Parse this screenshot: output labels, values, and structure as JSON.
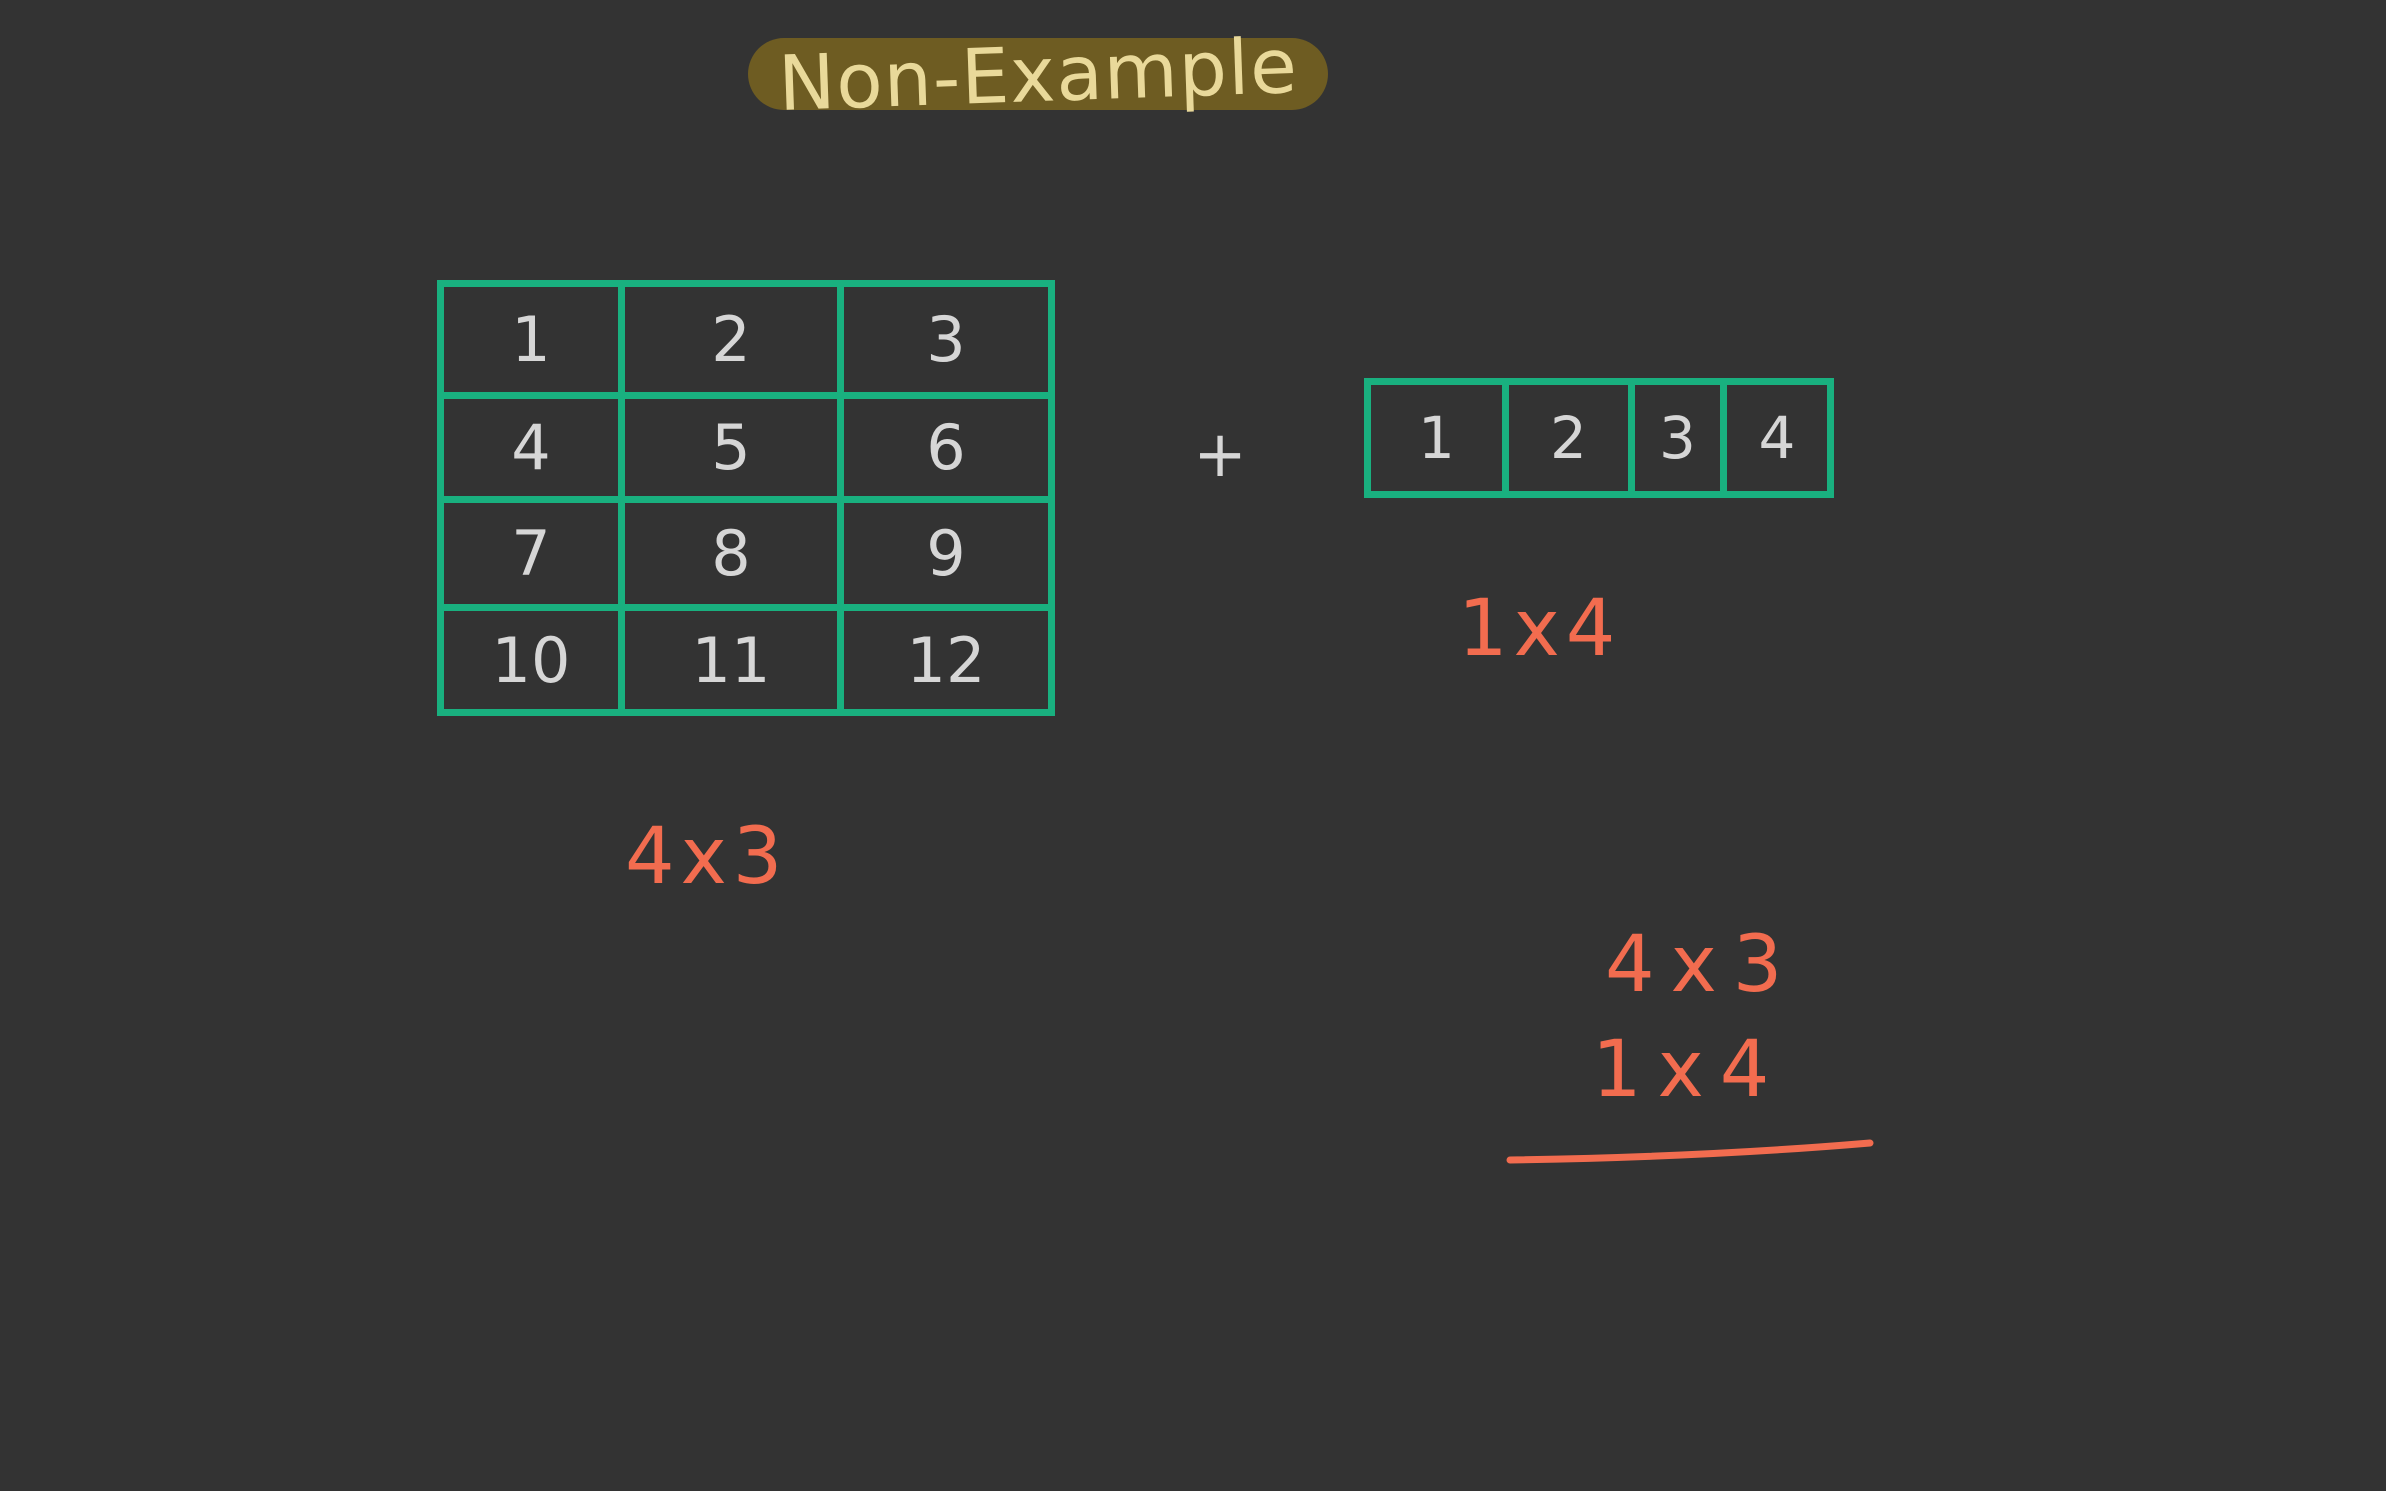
{
  "title": "Non-Example",
  "array_grid": {
    "cells": [
      "1",
      "2",
      "3",
      "4",
      "5",
      "6",
      "7",
      "8",
      "9",
      "10",
      "11",
      "12"
    ]
  },
  "plus_sign": "+",
  "strip": {
    "cells": [
      "1",
      "2",
      "3",
      "4"
    ]
  },
  "labels": {
    "grid_expression": "4x3",
    "strip_expression": "1x4",
    "stack_line_1": "4x3",
    "stack_line_2": "1x4"
  },
  "colors": {
    "background": "#333333",
    "grid_lines": "#19b07f",
    "numbers": "#d6d6d6",
    "expressions": "#f26c4f",
    "title_pill": "#6e5c22",
    "title_text": "#e9d99a"
  }
}
